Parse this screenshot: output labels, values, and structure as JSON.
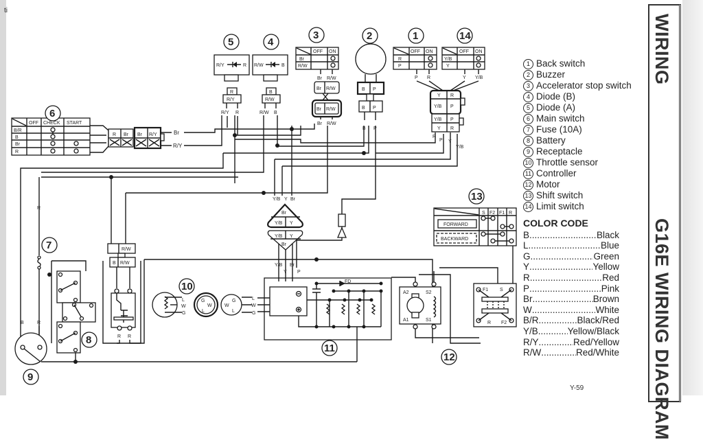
{
  "document": {
    "section_title": "WIRING",
    "diagram_title": "G16E WIRING DIAGRAM",
    "page_number": "Y-59",
    "margin_mark": "ti"
  },
  "components": [
    {
      "num": "1",
      "name": "Back switch"
    },
    {
      "num": "2",
      "name": "Buzzer"
    },
    {
      "num": "3",
      "name": "Accelerator stop switch"
    },
    {
      "num": "4",
      "name": "Diode (B)"
    },
    {
      "num": "5",
      "name": "Diode (A)"
    },
    {
      "num": "6",
      "name": "Main switch"
    },
    {
      "num": "7",
      "name": "Fuse (10A)"
    },
    {
      "num": "8",
      "name": "Battery"
    },
    {
      "num": "9",
      "name": "Receptacle"
    },
    {
      "num": "10",
      "name": "Throttle sensor"
    },
    {
      "num": "11",
      "name": "Controller"
    },
    {
      "num": "12",
      "name": "Motor"
    },
    {
      "num": "13",
      "name": "Shift switch"
    },
    {
      "num": "14",
      "name": "Limit switch"
    }
  ],
  "color_code": {
    "title": "COLOR CODE",
    "entries": [
      {
        "code": "B",
        "color": "Black"
      },
      {
        "code": "L",
        "color": "Blue"
      },
      {
        "code": "G",
        "color": "Green"
      },
      {
        "code": "Y",
        "color": "Yellow"
      },
      {
        "code": "R",
        "color": "Red"
      },
      {
        "code": "P",
        "color": "Pink"
      },
      {
        "code": "Br",
        "color": "Brown"
      },
      {
        "code": "W",
        "color": "White"
      },
      {
        "code": "B/R",
        "color": "Black/Red"
      },
      {
        "code": "Y/B",
        "color": "Yellow/Black"
      },
      {
        "code": "R/Y",
        "color": "Red/Yellow"
      },
      {
        "code": "R/W",
        "color": "Red/White"
      }
    ]
  },
  "main_switch_table": {
    "headers": [
      "OFF",
      "CHECK",
      "START"
    ],
    "rows": [
      "B/R",
      "B",
      "Br",
      "R"
    ]
  },
  "switch_tables": {
    "accelerator_stop": {
      "headers": [
        "OFF",
        "ON"
      ],
      "rows": [
        "Br",
        "R/W"
      ]
    },
    "back_switch": {
      "headers": [
        "OFF",
        "ON"
      ],
      "rows": [
        "R",
        "P"
      ]
    },
    "limit_switch": {
      "headers": [
        "OFF",
        "ON"
      ],
      "rows": [
        "Y/B",
        "Y"
      ]
    }
  },
  "shift_switch": {
    "headers": [
      "S",
      "F2",
      "F1",
      "R"
    ],
    "positions": [
      "FORWARD",
      "BACKWARD"
    ]
  },
  "diodes": {
    "diode_a": {
      "left": "R/Y",
      "right": "R"
    },
    "diode_b": {
      "left": "R/W",
      "right": "B"
    }
  },
  "wire_labels": {
    "br": "Br",
    "ry": "R/Y",
    "r": "R",
    "rw": "R/W",
    "b": "B",
    "p": "P",
    "y": "Y",
    "yb": "Y/B",
    "l": "L",
    "w": "W",
    "g": "G",
    "br_dot": "Br"
  },
  "controller": {
    "fd_label": "FD"
  },
  "motor": {
    "terminals": [
      "A2",
      "A1",
      "S2",
      "S1"
    ]
  },
  "reverse_contactor": {
    "terminals": [
      "F1",
      "S",
      "R",
      "F2"
    ]
  }
}
